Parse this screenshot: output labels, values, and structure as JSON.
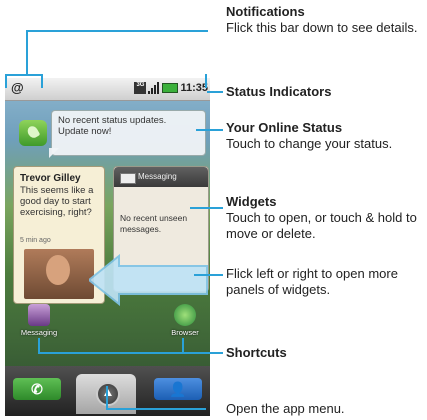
{
  "statusbar": {
    "app_icon": "@",
    "network": "3G",
    "time": "11:35"
  },
  "home": {
    "status_widget": {
      "text": "No recent status updates. Update now!"
    },
    "contact": {
      "name": "Trevor Gilley",
      "message": "This seems like a good day to start exercising, right?",
      "time": "5 min ago"
    },
    "messaging_widget": {
      "title": "Messaging",
      "body": "No recent unseen messages."
    },
    "shortcuts": [
      {
        "label": "Messaging"
      },
      {
        "label": "Browser"
      }
    ],
    "dock": {
      "phone_icon": "phone-icon",
      "contacts_icon": "contacts-icon",
      "launcher_icon": "launcher-up-icon"
    }
  },
  "callouts": [
    {
      "heading": "Notifications",
      "body": "Flick this bar down to see details."
    },
    {
      "heading": "Status Indicators",
      "body": ""
    },
    {
      "heading": "Your Online Status",
      "body": "Touch to change your status."
    },
    {
      "heading": "Widgets",
      "body": "Touch to open, or touch & hold to move or delete."
    },
    {
      "heading": "",
      "body": "Flick left or right to open more panels of widgets."
    },
    {
      "heading": "Shortcuts",
      "body": ""
    },
    {
      "heading": "",
      "body": "Open the app menu."
    }
  ]
}
